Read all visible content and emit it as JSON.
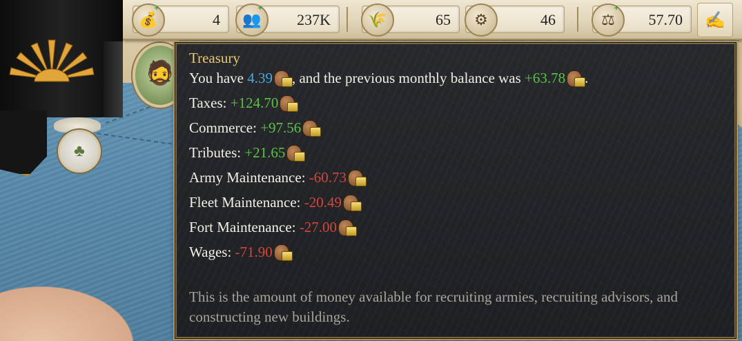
{
  "resources": [
    {
      "name": "gold-bag-icon",
      "value": "4",
      "plus": true
    },
    {
      "name": "population-icon",
      "value": "237K",
      "plus": true
    },
    {
      "name": "manpower-icon",
      "value": "65",
      "plus": false
    },
    {
      "name": "trade-icon",
      "value": "46",
      "plus": false
    },
    {
      "name": "stability-icon",
      "value": "57.70",
      "plus": true
    }
  ],
  "tooltip": {
    "title": "Treasury",
    "intro": {
      "prefix": "You have ",
      "amount": "4.39",
      "middle": ", and the previous monthly balance was ",
      "balance": "+63.78",
      "suffix": "."
    },
    "rows": [
      {
        "label": "Taxes:",
        "value": "+124.70",
        "sign": "pos"
      },
      {
        "label": "Commerce:",
        "value": "+97.56",
        "sign": "pos"
      },
      {
        "label": "Tributes:",
        "value": "+21.65",
        "sign": "pos"
      },
      {
        "label": "Army Maintenance:",
        "value": "-60.73",
        "sign": "neg"
      },
      {
        "label": "Fleet Maintenance:",
        "value": "-20.49",
        "sign": "neg"
      },
      {
        "label": "Fort Maintenance:",
        "value": "-27.00",
        "sign": "neg"
      },
      {
        "label": "Wages:",
        "value": "-71.90",
        "sign": "neg"
      }
    ],
    "description": "This is the amount of money available for recruiting armies, recruiting advisors, and constructing new buildings."
  },
  "colors": {
    "positive": "#5cc245",
    "negative": "#d6463a",
    "highlight": "#4aa8e0",
    "title": "#e8c876"
  }
}
